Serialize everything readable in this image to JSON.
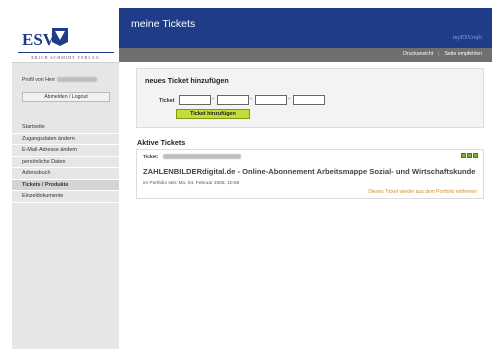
{
  "logo": {
    "text": "ESV",
    "subtitle": "ERICH SCHMIDT VERLAG"
  },
  "header": {
    "title": "meine Tickets",
    "brand": "myESV.info"
  },
  "subbar": {
    "print_view": "Druckansicht",
    "recommend": "Seite empfehlen"
  },
  "sidebar": {
    "profile_prefix": "Profil von Herr",
    "logout_label": "Abmelden / Logout",
    "items": [
      {
        "label": "Startseite",
        "active": false
      },
      {
        "label": "Zugangsdaten ändern",
        "active": false
      },
      {
        "label": "E-Mail-Adresse ändern",
        "active": false
      },
      {
        "label": "persönliche Daten",
        "active": false
      },
      {
        "label": "Adressbuch",
        "active": false
      },
      {
        "label": "Tickets / Produkte",
        "active": true
      },
      {
        "label": "Einzeldokumente",
        "active": false
      }
    ]
  },
  "new_ticket": {
    "title": "neues Ticket hinzufügen",
    "label": "Ticket",
    "button": "Ticket hinzufügen",
    "separator": "-"
  },
  "active_tickets": {
    "title": "Aktive Tickets",
    "ticket_label": "Ticket:",
    "name": "ZAHLENBILDERdigital.de - Online-Abonnement Arbeitsmappe Sozial- und Wirtschaftskunde",
    "date": "im Portfolio seit: Mo, 04. Februar 2008, 10:56",
    "remove": "Dieses Ticket wieder aus dem Portfolio entfernen"
  },
  "colors": {
    "header_blue": "#1f3c88",
    "button_green": "#c4dc3a",
    "status_green": "#79b32a",
    "link_orange": "#e08a1e"
  }
}
